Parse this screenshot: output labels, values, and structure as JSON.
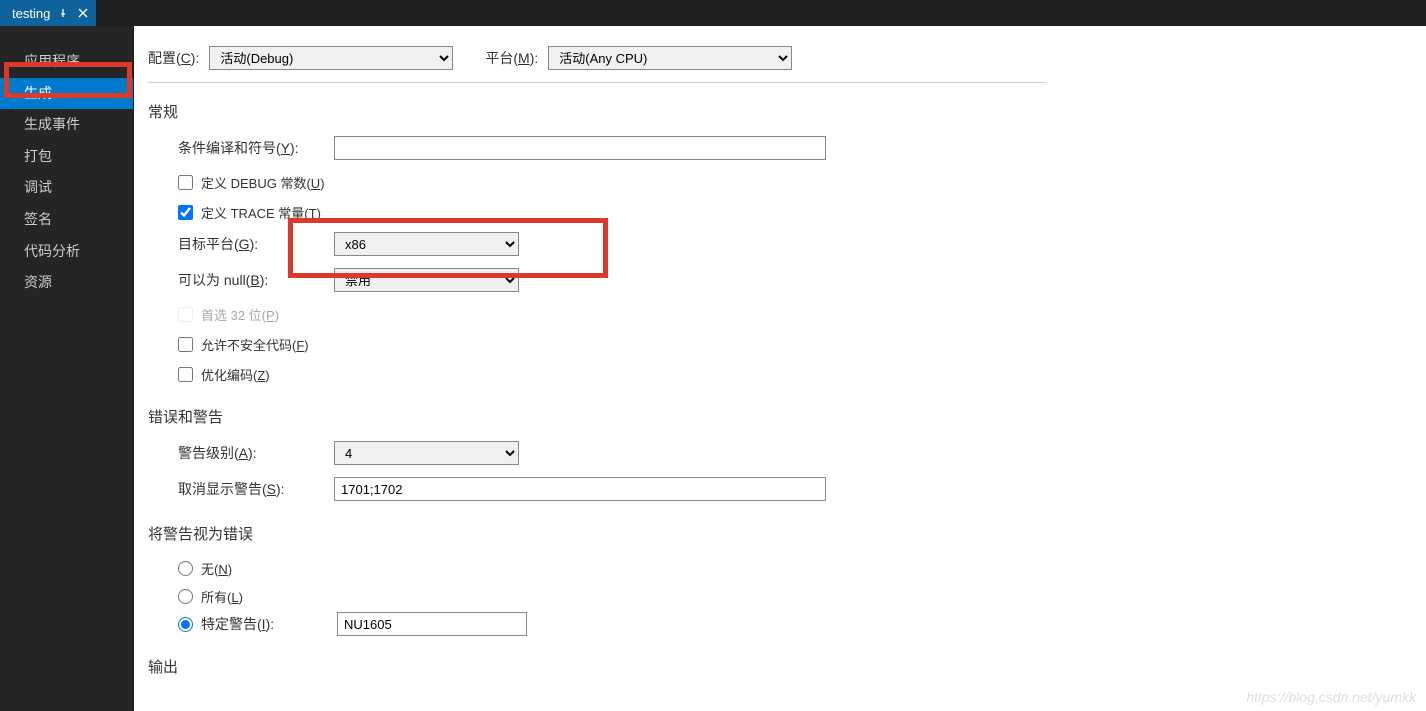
{
  "tab": {
    "title": "testing"
  },
  "sidebar": {
    "items": [
      {
        "label": "应用程序"
      },
      {
        "label": "生成"
      },
      {
        "label": "生成事件"
      },
      {
        "label": "打包"
      },
      {
        "label": "调试"
      },
      {
        "label": "签名"
      },
      {
        "label": "代码分析"
      },
      {
        "label": "资源"
      }
    ],
    "active_index": 1
  },
  "top": {
    "config_label_prefix": "配置(",
    "config_label_key": "C",
    "config_label_suffix": "):",
    "config_value": "活动(Debug)",
    "platform_label_prefix": "平台(",
    "platform_label_key": "M",
    "platform_label_suffix": "):",
    "platform_value": "活动(Any CPU)"
  },
  "sections": {
    "general": {
      "title": "常规",
      "cond_symbols_prefix": "条件编译和符号(",
      "cond_symbols_key": "Y",
      "cond_symbols_suffix": "):",
      "cond_symbols_value": "",
      "debug_const_prefix": "定义 DEBUG 常数(",
      "debug_const_key": "U",
      "debug_const_suffix": ")",
      "debug_const_checked": false,
      "trace_const_prefix": "定义 TRACE 常量(",
      "trace_const_key": "T",
      "trace_const_suffix": ")",
      "trace_const_checked": true,
      "target_platform_prefix": "目标平台(",
      "target_platform_key": "G",
      "target_platform_suffix": "):",
      "target_platform_value": "x86",
      "nullable_prefix": "可以为 null(",
      "nullable_key": "B",
      "nullable_suffix": "):",
      "nullable_value": "禁用",
      "prefer32_prefix": "首选 32 位(",
      "prefer32_key": "P",
      "prefer32_suffix": ")",
      "prefer32_checked": false,
      "unsafe_prefix": "允许不安全代码(",
      "unsafe_key": "F",
      "unsafe_suffix": ")",
      "unsafe_checked": false,
      "optimize_prefix": "优化编码(",
      "optimize_key": "Z",
      "optimize_suffix": ")",
      "optimize_checked": false
    },
    "errors": {
      "title": "错误和警告",
      "warning_level_prefix": "警告级别(",
      "warning_level_key": "A",
      "warning_level_suffix": "):",
      "warning_level_value": "4",
      "suppress_prefix": "取消显示警告(",
      "suppress_key": "S",
      "suppress_suffix": "):",
      "suppress_value": "1701;1702"
    },
    "treat": {
      "title": "将警告视为错误",
      "none_prefix": "无(",
      "none_key": "N",
      "none_suffix": ")",
      "all_prefix": "所有(",
      "all_key": "L",
      "all_suffix": ")",
      "specific_prefix": "特定警告(",
      "specific_key": "I",
      "specific_suffix": "):",
      "specific_value": "NU1605",
      "selected": "specific"
    },
    "output": {
      "title": "输出"
    }
  },
  "watermark": "https://blog.csdn.net/yumkk"
}
